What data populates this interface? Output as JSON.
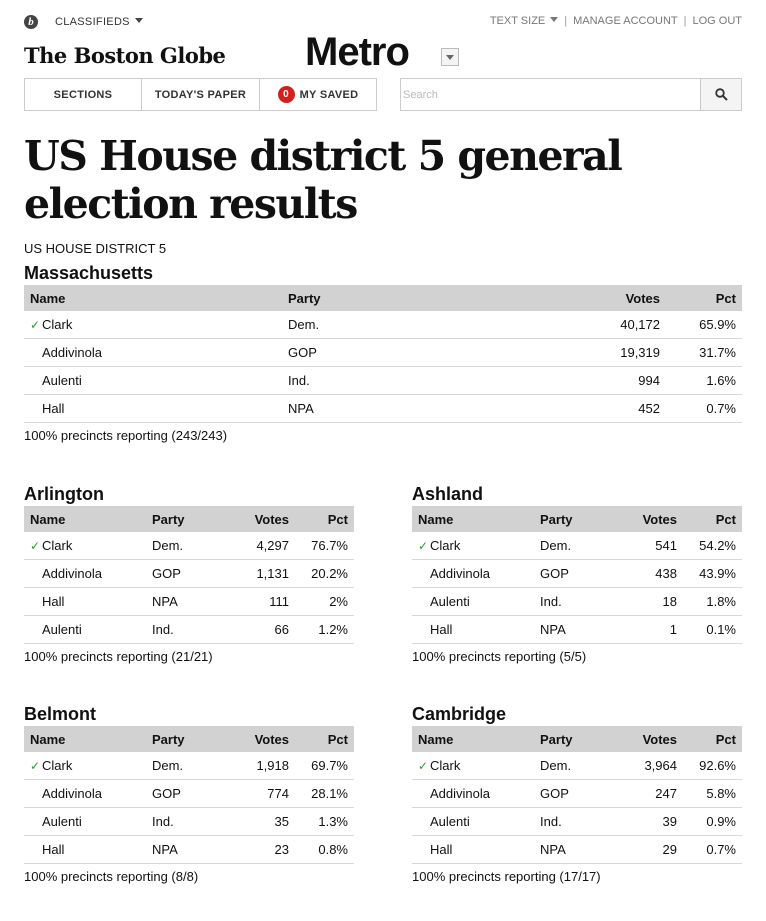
{
  "header": {
    "logo_letter": "b",
    "classifieds": "CLASSIFIEDS",
    "links": [
      "TEXT SIZE",
      "MANAGE ACCOUNT",
      "LOG OUT"
    ],
    "globe": "The Boston Globe",
    "section": "Metro"
  },
  "nav": {
    "sections": "SECTIONS",
    "todays_paper": "TODAY'S PAPER",
    "saved_count": "0",
    "my_saved": "MY SAVED"
  },
  "search": {
    "placeholder": "Search"
  },
  "headline": "US House district 5 general election results",
  "district": "US HOUSE DISTRICT 5",
  "columns": {
    "name": "Name",
    "party": "Party",
    "votes": "Votes",
    "pct": "Pct"
  },
  "results": [
    {
      "area": "Massachusetts",
      "reporting": "100% precincts reporting (243/243)",
      "rows": [
        {
          "winner": true,
          "name": "Clark",
          "party": "Dem.",
          "votes": "40,172",
          "pct": "65.9%"
        },
        {
          "winner": false,
          "name": "Addivinola",
          "party": "GOP",
          "votes": "19,319",
          "pct": "31.7%"
        },
        {
          "winner": false,
          "name": "Aulenti",
          "party": "Ind.",
          "votes": "994",
          "pct": "1.6%"
        },
        {
          "winner": false,
          "name": "Hall",
          "party": "NPA",
          "votes": "452",
          "pct": "0.7%"
        }
      ]
    },
    {
      "area": "Arlington",
      "reporting": "100% precincts reporting (21/21)",
      "rows": [
        {
          "winner": true,
          "name": "Clark",
          "party": "Dem.",
          "votes": "4,297",
          "pct": "76.7%"
        },
        {
          "winner": false,
          "name": "Addivinola",
          "party": "GOP",
          "votes": "1,131",
          "pct": "20.2%"
        },
        {
          "winner": false,
          "name": "Hall",
          "party": "NPA",
          "votes": "111",
          "pct": "2%"
        },
        {
          "winner": false,
          "name": "Aulenti",
          "party": "Ind.",
          "votes": "66",
          "pct": "1.2%"
        }
      ]
    },
    {
      "area": "Ashland",
      "reporting": "100% precincts reporting (5/5)",
      "rows": [
        {
          "winner": true,
          "name": "Clark",
          "party": "Dem.",
          "votes": "541",
          "pct": "54.2%"
        },
        {
          "winner": false,
          "name": "Addivinola",
          "party": "GOP",
          "votes": "438",
          "pct": "43.9%"
        },
        {
          "winner": false,
          "name": "Aulenti",
          "party": "Ind.",
          "votes": "18",
          "pct": "1.8%"
        },
        {
          "winner": false,
          "name": "Hall",
          "party": "NPA",
          "votes": "1",
          "pct": "0.1%"
        }
      ]
    },
    {
      "area": "Belmont",
      "reporting": "100% precincts reporting (8/8)",
      "rows": [
        {
          "winner": true,
          "name": "Clark",
          "party": "Dem.",
          "votes": "1,918",
          "pct": "69.7%"
        },
        {
          "winner": false,
          "name": "Addivinola",
          "party": "GOP",
          "votes": "774",
          "pct": "28.1%"
        },
        {
          "winner": false,
          "name": "Aulenti",
          "party": "Ind.",
          "votes": "35",
          "pct": "1.3%"
        },
        {
          "winner": false,
          "name": "Hall",
          "party": "NPA",
          "votes": "23",
          "pct": "0.8%"
        }
      ]
    },
    {
      "area": "Cambridge",
      "reporting": "100% precincts reporting (17/17)",
      "rows": [
        {
          "winner": true,
          "name": "Clark",
          "party": "Dem.",
          "votes": "3,964",
          "pct": "92.6%"
        },
        {
          "winner": false,
          "name": "Addivinola",
          "party": "GOP",
          "votes": "247",
          "pct": "5.8%"
        },
        {
          "winner": false,
          "name": "Aulenti",
          "party": "Ind.",
          "votes": "39",
          "pct": "0.9%"
        },
        {
          "winner": false,
          "name": "Hall",
          "party": "NPA",
          "votes": "29",
          "pct": "0.7%"
        }
      ]
    }
  ],
  "icons": {
    "winner_check": "checkmark-icon",
    "search": "search-icon",
    "dropdown": "chevron-down-icon"
  },
  "colors": {
    "badge": "#d41f1f",
    "check": "#2e9a2e",
    "table_header": "#d2d2d2"
  }
}
